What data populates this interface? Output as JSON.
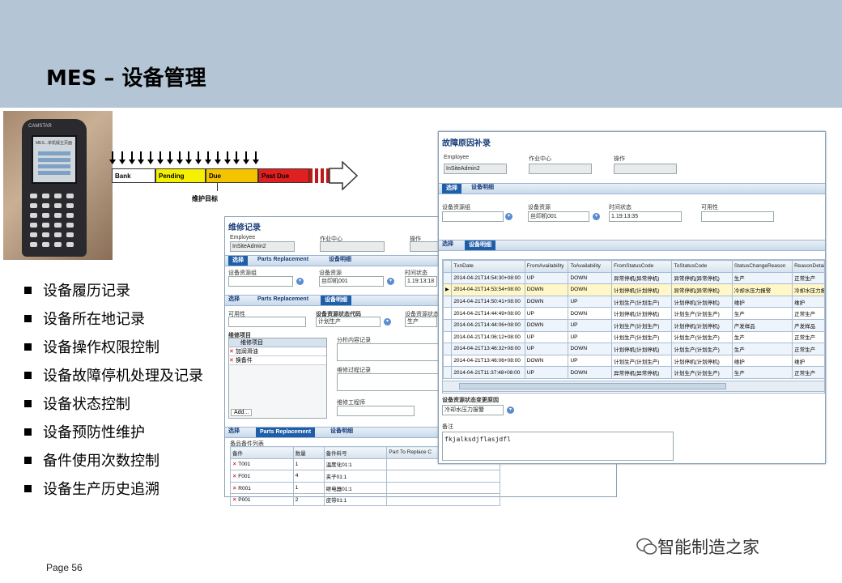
{
  "slide": {
    "title": "MES  – 设备管理",
    "page": "Page 56",
    "watermark": "智能制造之家",
    "colors": {
      "header": "#b4c6d6",
      "accent": "#1f5ea8"
    }
  },
  "bullets": [
    "设备履历记录",
    "设备所在地记录",
    "设备操作权限控制",
    "设备故障停机处理及记录",
    "设备状态控制",
    "设备预防性维护",
    "备件使用次数控制",
    "设备生产历史追溯"
  ],
  "device": {
    "brand": "CAMSTAR",
    "screen_title": "MES...单机版主页面"
  },
  "timeline": {
    "segments": [
      {
        "label": "Bank",
        "color": "#ffffff"
      },
      {
        "label": "Pending",
        "color": "#f4f000"
      },
      {
        "label": "Due",
        "color": "#f5c400"
      },
      {
        "label": "Past Due",
        "color": "#e02020"
      }
    ],
    "target_label": "维护目标"
  },
  "repair": {
    "title": "维修记录",
    "employee_label": "Employee",
    "employee_value": "InSiteAdmin2",
    "workcenter_label": "作业中心",
    "operation_label": "操作",
    "tabs1": {
      "select": "选择",
      "parts": "Parts Replacement",
      "detail": "设备明细"
    },
    "res_group_label": "设备资源组",
    "resource_label": "设备资源",
    "resource_value": "丝印机001",
    "time_label": "时间状态",
    "time_value": "1.19:13:18",
    "tabs2": {
      "select": "选择",
      "parts": "Parts Replacement",
      "detail": "设备明细"
    },
    "availability_label": "可用性",
    "status_code_label": "设备资源状态代码",
    "status_code_value": "计划生产",
    "status_reason_label": "设备资源状态原",
    "status_reason_value": "生产",
    "repair_items_label": "维修项目",
    "repair_items_header": "维修项目",
    "repair_items": [
      "加润滑油",
      "换备件"
    ],
    "analysis_label": "分析内容记录",
    "process_label": "维修过程记录",
    "engineer_label": "维修工程师",
    "add_label": "Add...",
    "tabs3": {
      "select": "选择",
      "parts": "Parts Replacement",
      "detail": "设备明细"
    },
    "parts_list_label": "备品备件列表",
    "parts_columns": [
      "备件",
      "数量",
      "备件料号",
      "Part To Replace C"
    ],
    "parts_rows": [
      {
        "part": "T001",
        "qty": "1",
        "pn": "温度化01:1"
      },
      {
        "part": "F001",
        "qty": "4",
        "pn": "夹子01:1"
      },
      {
        "part": "R001",
        "qty": "1",
        "pn": "继电器01:1"
      },
      {
        "part": "P001",
        "qty": "2",
        "pn": "皮带01:1"
      }
    ]
  },
  "fault": {
    "title": "故障原因补录",
    "employee_label": "Employee",
    "employee_value": "InSiteAdmin2",
    "workcenter_label": "作业中心",
    "operation_label": "操作",
    "tab1": {
      "select": "选择",
      "detail": "设备明细"
    },
    "res_group_label": "设备资源组",
    "resource_label": "设备资源",
    "resource_value": "丝印机001",
    "time_label": "时间状态",
    "time_value": "1.19:13:35",
    "availability_label": "可用性",
    "tab2": {
      "select": "选择",
      "detail": "设备明细"
    },
    "columns": [
      "TxnDate",
      "FromAvailability",
      "ToAvailability",
      "FromStatusCode",
      "ToStatusCode",
      "StatusChangeReason",
      "ReasonDetail"
    ],
    "rows": [
      [
        "2014-04-21T14:54:30+08:00",
        "UP",
        "DOWN",
        "异常停机(异常停机)",
        "异常停机(异常停机)",
        "生产",
        "正常生产"
      ],
      [
        "2014-04-21T14:53:54+08:00",
        "DOWN",
        "DOWN",
        "计划停机(计划停机)",
        "异常停机(异常停机)",
        "冷却水压力报警",
        "冷却水压力报警"
      ],
      [
        "2014-04-21T14:50:41+08:00",
        "DOWN",
        "UP",
        "计划生产(计划生产)",
        "计划停机(计划停机)",
        "维护",
        "维护"
      ],
      [
        "2014-04-21T14:44:49+08:00",
        "UP",
        "DOWN",
        "计划停机(计划停机)",
        "计划生产(计划生产)",
        "生产",
        "正常生产"
      ],
      [
        "2014-04-21T14:44:06+08:00",
        "DOWN",
        "UP",
        "计划生产(计划生产)",
        "计划停机(计划停机)",
        "产发样品",
        "产发样品"
      ],
      [
        "2014-04-21T14:06:12+08:00",
        "UP",
        "UP",
        "计划生产(计划生产)",
        "计划生产(计划生产)",
        "生产",
        "正常生产"
      ],
      [
        "2014-04-21T13:46:32+08:00",
        "UP",
        "DOWN",
        "计划停机(计划停机)",
        "计划生产(计划生产)",
        "生产",
        "正常生产"
      ],
      [
        "2014-04-21T13:46:06+08:00",
        "DOWN",
        "UP",
        "计划生产(计划生产)",
        "计划停机(计划停机)",
        "维护",
        "维护"
      ],
      [
        "2014-04-21T11:37:48+08:00",
        "UP",
        "DOWN",
        "异常停机(异常停机)",
        "计划生产(计划生产)",
        "生产",
        "正常生产"
      ]
    ],
    "change_reason_label": "设备资源状态变更原因",
    "change_reason_value": "冷却水压力报警",
    "remark_label": "备注",
    "remark_value": "fkjalksdjflasjdfl"
  }
}
